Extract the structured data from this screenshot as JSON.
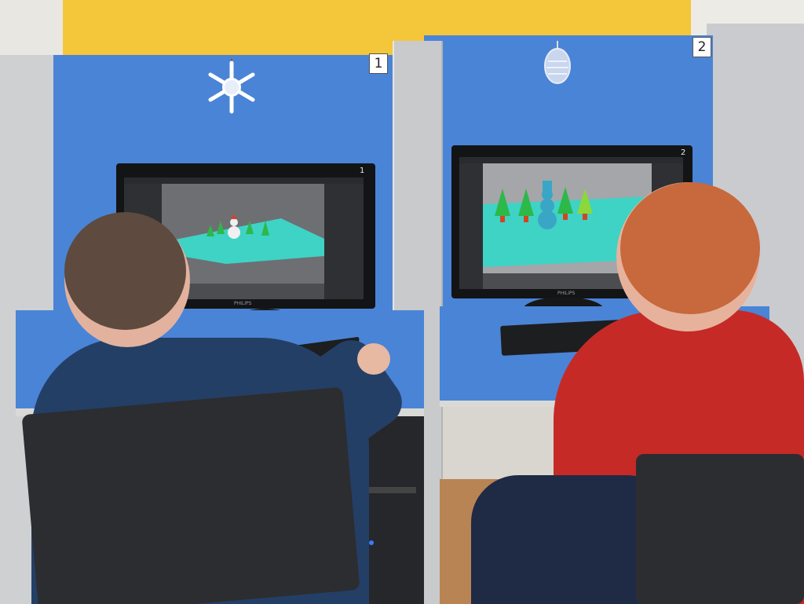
{
  "booth_labels": {
    "left": "1",
    "right": "2"
  },
  "monitor_labels": {
    "left": "1",
    "right": "2"
  },
  "monitor_brand": "PHILIPS",
  "colors": {
    "wall_yellow": "#f4c63a",
    "booth_blue": "#4a84d6",
    "floor_teal": "#3ed3c5",
    "tree_green": "#2db84a",
    "red_hoodie": "#c62a26",
    "navy_sweater": "#243f66"
  },
  "icons": [
    "snowflake-ornament",
    "christmas-ball-ornament"
  ]
}
